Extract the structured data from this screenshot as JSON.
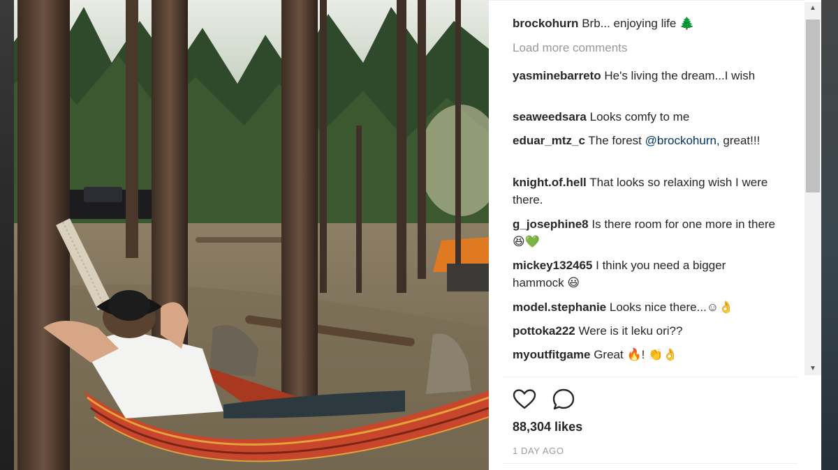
{
  "post": {
    "caption_user": "brockohurn",
    "caption_text": "Brb... enjoying life 🌲",
    "load_more": "Load more comments",
    "comments": [
      {
        "user": "yasminebarreto",
        "text": "He's living the dream...I wish"
      },
      {
        "user": "seaweedsara",
        "text": "Looks comfy to me"
      },
      {
        "user": "eduar_mtz_c",
        "text": "The forest ",
        "mention": "@brockohurn,",
        "text_after": " great!!!"
      },
      {
        "user": "knight.of.hell",
        "text": "That looks so relaxing wish I were there."
      },
      {
        "user": "g_josephine8",
        "text": "Is there room for one more in there 😆💚"
      },
      {
        "user": "mickey132465",
        "text": "I think you need a bigger hammock 😃"
      },
      {
        "user": "model.stephanie",
        "text": "Looks nice there...☺👌"
      },
      {
        "user": "pottoka222",
        "text": "Were is it leku ori??"
      },
      {
        "user": "myoutfitgame",
        "text": "Great 🔥! 👏👌"
      }
    ],
    "likes": "88,304 likes",
    "timestamp": "1 DAY AGO"
  },
  "icons": {
    "like": "heart-outline-icon",
    "comment": "speech-bubble-icon",
    "scroll_up": "triangle-up",
    "scroll_down": "triangle-down"
  },
  "colors": {
    "text": "#262626",
    "muted": "#999999",
    "mention": "#003569",
    "hammock": "#c8462c"
  }
}
